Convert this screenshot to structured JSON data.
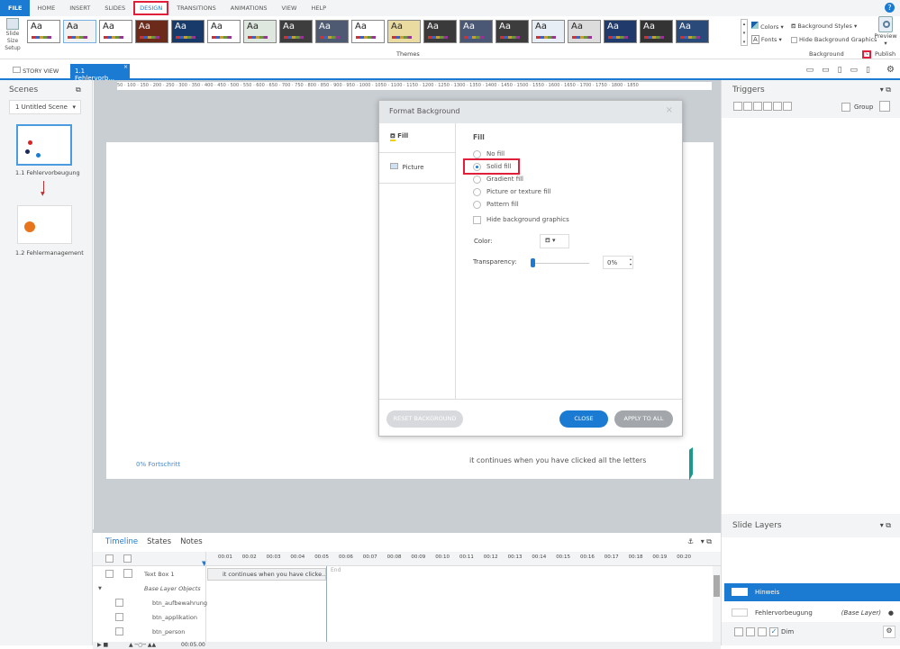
{
  "tabs": [
    "FILE",
    "HOME",
    "INSERT",
    "SLIDES",
    "DESIGN",
    "TRANSITIONS",
    "ANIMATIONS",
    "VIEW",
    "HELP"
  ],
  "ribbon": {
    "slide_size": "Slide Size",
    "setup": "Setup",
    "themes_label": "Themes",
    "theme_sample": "Aa",
    "themes": [
      "#ffffff",
      "#f2f2f2",
      "#ffffff",
      "#6b2a1a",
      "#173a6b",
      "#ffffff",
      "#dfe8df",
      "#3d3d3d",
      "#4e5a72",
      "#ffffff",
      "#eadca0",
      "#3a3a3a",
      "#4b5875",
      "#3c3c3c",
      "#e8eef5",
      "#dcdcdc",
      "#1f3a6b",
      "#333333",
      "#2a4a7a"
    ],
    "colors": "Colors",
    "fonts": "Fonts",
    "background_styles": "Background Styles",
    "hide_bg_graphics": "Hide Background Graphics",
    "background_label": "Background",
    "preview": "Preview",
    "publish": "Publish"
  },
  "doc_tabs": {
    "story_view": "STORY VIEW",
    "current": "1.1 Fehlervorb..."
  },
  "scenes": {
    "title": "Scenes",
    "scene_select": "1 Untitled Scene",
    "slides": [
      {
        "label": "1.1 Fehlervorbeugung"
      },
      {
        "label": "1.2 Fehlermanagement"
      }
    ]
  },
  "ruler_top": "50 · 100 · 150 · 200 · 250 · 300 · 350 · 400 · 450 · 500 · 550 · 600 · 650 · 700 · 750 · 800 · 850 · 900 · 950 · 1000 · 1050 · 1100 · 1150 · 1200 · 1250 · 1300 · 1350 · 1400 · 1450 · 1500 · 1550 · 1600 · 1650 · 1700 · 1750 · 1800 · 1850",
  "slide": {
    "progress": "0% Fortschritt",
    "text": "it continues when you have clicked all the letters"
  },
  "dialog": {
    "title": "Format Background",
    "nav": [
      "Fill",
      "Picture"
    ],
    "section": "Fill",
    "options": [
      "No fill",
      "Solid fill",
      "Gradient fill",
      "Picture or texture fill",
      "Pattern fill"
    ],
    "selected": 1,
    "hide_bg": "Hide background graphics",
    "color_label": "Color:",
    "transparency_label": "Transparency:",
    "transparency": "0%",
    "transparency_value": 0,
    "reset": "RESET BACKGROUND",
    "close": "CLOSE",
    "apply_all": "APPLY TO ALL"
  },
  "triggers": {
    "title": "Triggers",
    "group": "Group"
  },
  "layers": {
    "title": "Slide Layers",
    "items": [
      {
        "name": "Hinweis",
        "tag": ""
      },
      {
        "name": "Fehlervorbeugung",
        "tag": "(Base Layer)"
      }
    ],
    "dim": "Dim"
  },
  "timeline": {
    "tabs": [
      "Timeline",
      "States",
      "Notes"
    ],
    "times": [
      "00:01",
      "00:02",
      "00:03",
      "00:04",
      "00:05",
      "00:06",
      "00:07",
      "00:08",
      "00:09",
      "00:10",
      "00:11",
      "00:12",
      "00:13",
      "00:14",
      "00:15",
      "00:16",
      "00:17",
      "00:18",
      "00:19",
      "00:20"
    ],
    "rows": [
      {
        "name": "Text Box 1"
      },
      {
        "name": "Base Layer Objects"
      },
      {
        "name": "btn_aufbewahrung"
      },
      {
        "name": "btn_applikation"
      },
      {
        "name": "btn_person"
      }
    ],
    "clip": "it continues when you have clicke...",
    "end": "End",
    "duration": "00:05.00"
  },
  "accent": "#1b7bd3",
  "highlight": "#e0203a"
}
